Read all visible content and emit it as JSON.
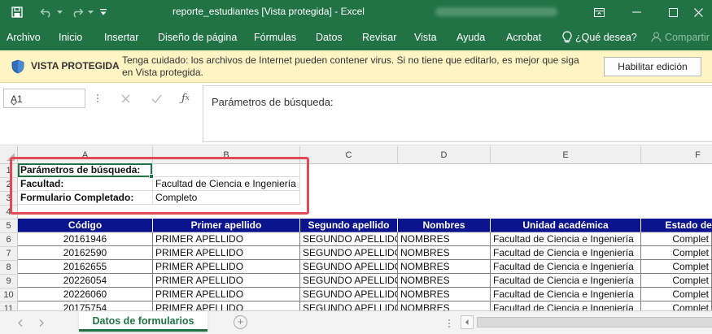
{
  "window": {
    "title": "reporte_estudiantes  [Vista protegida]  -  Excel",
    "accent": "#217346"
  },
  "ribbon": {
    "tabs": [
      "Archivo",
      "Inicio",
      "Insertar",
      "Diseño de página",
      "Fórmulas",
      "Datos",
      "Revisar",
      "Vista",
      "Ayuda",
      "Acrobat"
    ],
    "tell_me": "¿Qué desea?",
    "share": "Compartir"
  },
  "protected_view": {
    "title": "VISTA PROTEGIDA",
    "message": "Tenga cuidado: los archivos de Internet pueden contener virus. Si no tiene que editarlo, es mejor que siga en Vista protegida.",
    "button": "Habilitar edición",
    "color": "#fff4c4"
  },
  "formula_bar": {
    "name_box": "A1",
    "formula": "Parámetros de búsqueda:"
  },
  "grid": {
    "columns": [
      "A",
      "B",
      "C",
      "D",
      "E",
      "F"
    ],
    "rows": [
      "1",
      "2",
      "3",
      "4",
      "5",
      "6",
      "7",
      "8",
      "9",
      "10",
      "11"
    ],
    "params": [
      {
        "label": "Parámetros de búsqueda:",
        "value": ""
      },
      {
        "label": "Facultad:",
        "value": "Facultad de Ciencia e Ingeniería"
      },
      {
        "label": "Formulario Completado:",
        "value": "Completo"
      }
    ],
    "header_color": "#0b148c",
    "table_headers": [
      "Código",
      "Primer apellido",
      "Segundo apellido",
      "Nombres",
      "Unidad académica",
      "Estado del for"
    ],
    "table_rows": [
      [
        "20161946",
        "PRIMER APELLIDO",
        "SEGUNDO APELLIDO",
        "NOMBRES",
        "Facultad de Ciencia e Ingeniería",
        "Complet"
      ],
      [
        "20162590",
        "PRIMER APELLIDO",
        "SEGUNDO APELLIDO",
        "NOMBRES",
        "Facultad de Ciencia e Ingeniería",
        "Complet"
      ],
      [
        "20162655",
        "PRIMER APELLIDO",
        "SEGUNDO APELLIDO",
        "NOMBRES",
        "Facultad de Ciencia e Ingeniería",
        "Complet"
      ],
      [
        "20226054",
        "PRIMER APELLIDO",
        "SEGUNDO APELLIDO",
        "NOMBRES",
        "Facultad de Ciencia e Ingeniería",
        "Complet"
      ],
      [
        "20226060",
        "PRIMER APELLIDO",
        "SEGUNDO APELLIDO",
        "NOMBRES",
        "Facultad de Ciencia e Ingeniería",
        "Complet"
      ],
      [
        "20175754",
        "PRIMER APELLIDO",
        "SEGUNDO APELLIDO",
        "NOMBRES",
        "Facultad de Ciencia e Ingeniería",
        "Complet"
      ]
    ]
  },
  "sheets": {
    "active": "Datos de formularios",
    "add_label": "+"
  }
}
